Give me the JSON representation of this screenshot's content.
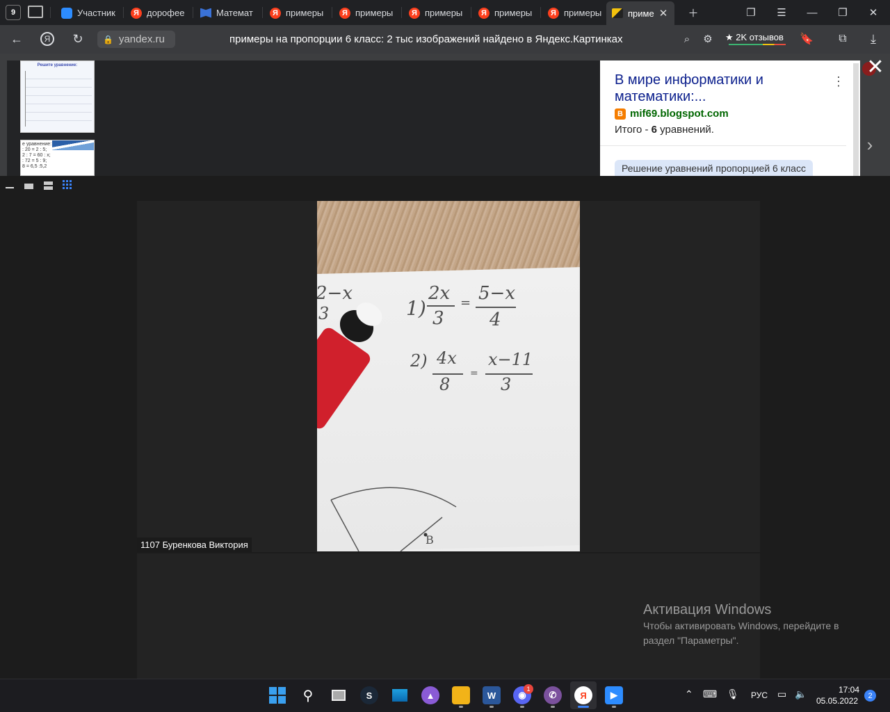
{
  "browser": {
    "tab_counter": "9",
    "tabs": [
      {
        "label": "Участник",
        "icon": "zoom-icon"
      },
      {
        "label": "дорофее",
        "icon": "yandex-icon"
      },
      {
        "label": "Математ",
        "icon": "book-icon"
      },
      {
        "label": "примеры",
        "icon": "yandex-icon"
      },
      {
        "label": "примеры",
        "icon": "yandex-icon"
      },
      {
        "label": "примеры",
        "icon": "yandex-icon"
      },
      {
        "label": "примеры",
        "icon": "yandex-icon"
      },
      {
        "label": "примеры",
        "icon": "yandex-icon"
      },
      {
        "label": "приме",
        "icon": "images-icon",
        "active": true
      }
    ],
    "domain": "yandex.ru",
    "page_title": "примеры на пропорции 6 класс: 2 тыс изображений найдено в Яндекс.Картинках",
    "reviews": "2K отзывов",
    "extension_badge": "1"
  },
  "image_viewer": {
    "card_title": "В мире информатики и математики:...",
    "card_source": "mif69.blogspot.com",
    "card_summary_prefix": "Итого - ",
    "card_summary_count": "6",
    "card_summary_suffix": " уравнений.",
    "card_tag": "Решение уравнений пропорцией 6 класс",
    "thumb1_title": "Решите уравнение:",
    "thumb2_lines": [
      "е уравнение:",
      ": 20 = 2 : 5;",
      "2 : 7 = 60 : x;",
      ": 72 = 5 : 9;",
      "8 = 6,5 :5,2"
    ]
  },
  "zoom": {
    "participant_name": "1107 Буренкова Виктория",
    "handwriting": {
      "eq1_num": "1)",
      "eq1_left_num": "2x",
      "eq1_left_den": "3",
      "eq1_sign": "=",
      "eq1_right_num": "5−x",
      "eq1_right_den": "4",
      "eq2_num": "2)",
      "eq2_left_num": "4x",
      "eq2_left_den": "8",
      "eq2_sign": "=",
      "eq2_right_num": "x−11",
      "eq2_right_den": "3",
      "side_text": "2−x",
      "side_den": "3",
      "point_label": "B"
    }
  },
  "activation": {
    "title": "Активация Windows",
    "body": "Чтобы активировать Windows, перейдите в раздел \"Параметры\"."
  },
  "taskbar": {
    "discord_badge": "1",
    "language": "РУС",
    "time": "17:04",
    "date": "05.05.2022",
    "notifications": "2"
  }
}
